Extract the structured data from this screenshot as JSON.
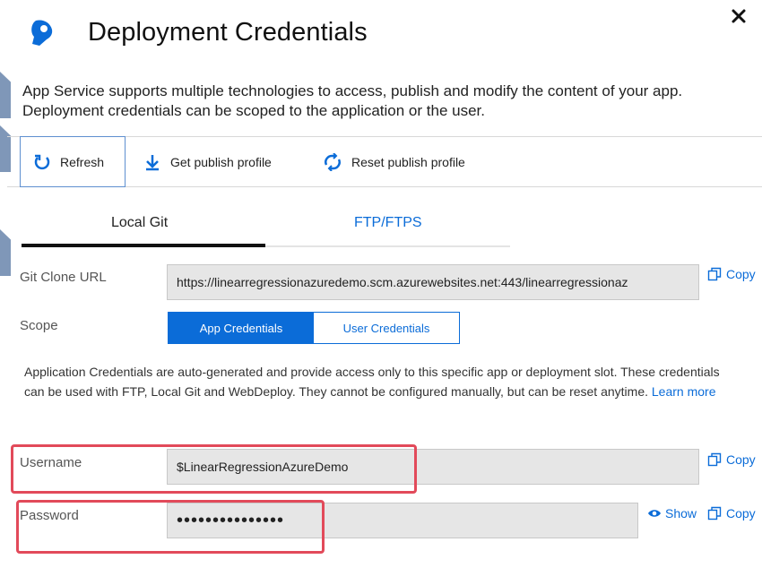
{
  "dialog": {
    "title": "Deployment Credentials",
    "description": "App Service supports multiple technologies to access, publish and modify the content of your app. Deployment credentials can be scoped to the application or the user."
  },
  "toolbar": {
    "refresh_label": "Refresh",
    "get_publish_profile_label": "Get publish profile",
    "reset_publish_profile_label": "Reset publish profile"
  },
  "tabs": [
    {
      "label": "Local Git",
      "selected": true
    },
    {
      "label": "FTP/FTPS",
      "selected": false
    }
  ],
  "git_clone": {
    "label": "Git Clone URL",
    "value": "https://linearregressionazuredemo.scm.azurewebsites.net:443/linearregressionaz",
    "copy_label": "Copy"
  },
  "scope": {
    "label": "Scope",
    "options": [
      "App Credentials",
      "User Credentials"
    ],
    "selected": "App Credentials"
  },
  "info": {
    "text": "Application Credentials are auto-generated and provide access only to this specific app or deployment slot. These credentials can be used with FTP, Local Git and WebDeploy. They cannot be configured manually, but can be reset anytime.",
    "link": "Learn more"
  },
  "username": {
    "label": "Username",
    "value": "$LinearRegressionAzureDemo",
    "copy_label": "Copy"
  },
  "password": {
    "label": "Password",
    "value": "•••••••••••••••",
    "show_label": "Show",
    "copy_label": "Copy"
  },
  "colors": {
    "accent": "#0b6cd8",
    "highlight": "#e24a5a",
    "field_bg": "#e6e6e6"
  }
}
